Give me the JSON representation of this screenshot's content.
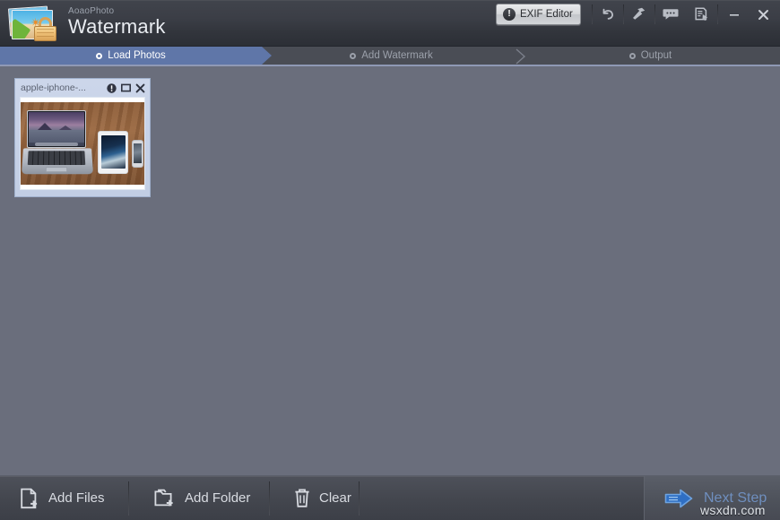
{
  "app": {
    "brand_sub": "AoaoPhoto",
    "brand_main": "Watermark",
    "logo_icon": "photo-lock-icon"
  },
  "titlebar": {
    "exif_button": {
      "label": "EXIF Editor",
      "icon": "exclamation-circle-icon"
    },
    "tools": [
      {
        "name": "undo-icon",
        "title": "Undo"
      },
      {
        "name": "wrench-icon",
        "title": "Tools"
      },
      {
        "name": "feedback-bubble-icon",
        "title": "Feedback"
      },
      {
        "name": "register-document-icon",
        "title": "Register"
      }
    ],
    "window_controls": [
      {
        "name": "minimize-button",
        "glyph": "–"
      },
      {
        "name": "close-button",
        "glyph": "✕"
      }
    ]
  },
  "steps": [
    {
      "label": "Load Photos",
      "state": "active"
    },
    {
      "label": "Add Watermark",
      "state": "inactive"
    },
    {
      "label": "Output",
      "state": "inactive"
    }
  ],
  "canvas": {
    "thumbnails": [
      {
        "title": "apple-iphone-...",
        "buttons": [
          {
            "name": "info-icon",
            "label": "Info"
          },
          {
            "name": "preview-maximize-icon",
            "label": "Preview"
          },
          {
            "name": "remove-close-icon",
            "label": "Remove"
          }
        ],
        "image_description": "MacBook, iPad and iPhone on a wooden desk"
      }
    ]
  },
  "bottombar": {
    "buttons": [
      {
        "label": "Add Files",
        "icon": "file-add-icon"
      },
      {
        "label": "Add Folder",
        "icon": "folder-add-icon"
      },
      {
        "label": "Clear",
        "icon": "trash-icon"
      }
    ],
    "next_step": {
      "label": "Next Step",
      "icon": "arrow-right-icon"
    }
  },
  "overlay": {
    "watermark_text": "wsxdn.com"
  },
  "colors": {
    "accent_blue": "#5f76a8",
    "canvas_bg": "#6a6e7c",
    "titlebar_bg": "#3b3e46",
    "bottombar_bg": "#44474f",
    "next_step_text": "#6f8fbf"
  }
}
